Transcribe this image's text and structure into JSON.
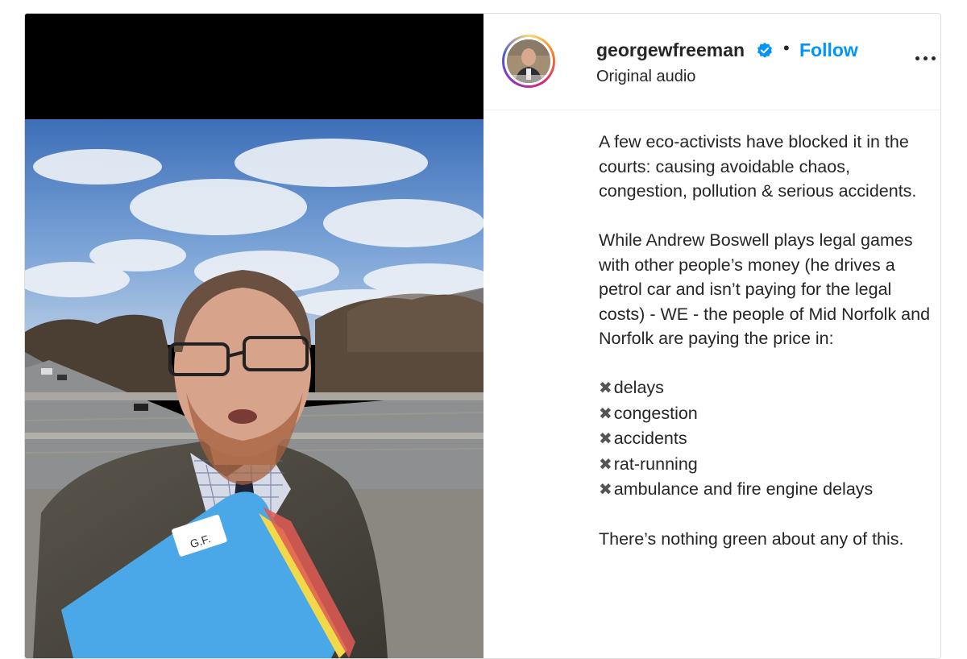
{
  "post": {
    "username": "georgewfreeman",
    "separator": "•",
    "follow_label": "Follow",
    "subtitle": "Original audio",
    "more_icon": "more-options-icon",
    "verified_icon": "verified-badge-icon",
    "colors": {
      "follow": "#0095f6",
      "verified": "#0095f6",
      "text": "#262626"
    }
  },
  "caption": {
    "paragraph1": "A few eco-activists have blocked it in the courts: causing avoidable chaos, congestion, pollution & serious accidents.",
    "paragraph2": "While Andrew Boswell plays legal games with other people’s money (he drives a petrol car and isn’t paying for the legal costs) - WE - the people of Mid Norfolk and Norfolk are paying the price in:",
    "list_marker": "✖",
    "list": [
      "delays",
      "congestion",
      "accidents",
      "rat-running",
      "ambulance and fire engine delays"
    ],
    "paragraph3": "There’s nothing green about any of this."
  },
  "video": {
    "folder_label": "G.F."
  }
}
